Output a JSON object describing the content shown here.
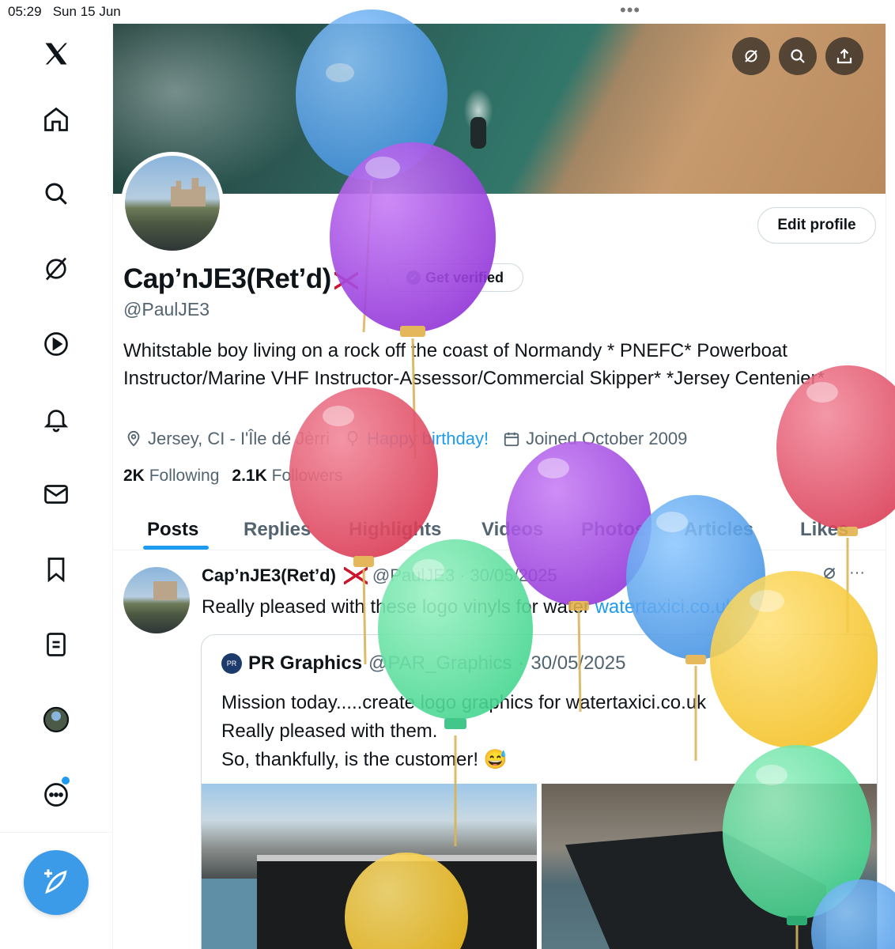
{
  "status": {
    "time": "05:29",
    "date": "Sun 15 Jun"
  },
  "banner": {
    "icons": [
      "grok-icon",
      "search-icon",
      "share-icon"
    ]
  },
  "profile": {
    "name": "Cap’nJE3(Ret’d)",
    "get_verified": "Get verified",
    "handle": "@PaulJE3",
    "bio": "Whitstable boy living on a rock off the coast of Normandy * PNEFC* Powerboat Instructor/Marine VHF Instructor-Assessor/Commercial Skipper* *Jersey Centenier*",
    "location": "Jersey, CI - I'Île dé Jèrri",
    "birthday": "Happy birthday!",
    "joined": "Joined October 2009",
    "following_count": "2K",
    "following_label": "Following",
    "followers_count": "2.1K",
    "followers_label": "Followers",
    "edit_button": "Edit profile"
  },
  "tabs": [
    "Posts",
    "Replies",
    "Highlights",
    "Videos",
    "Photos",
    "Articles",
    "Likes"
  ],
  "post": {
    "author": "Cap’nJE3(Ret’d)",
    "handle": "@PaulJE3",
    "date": "30/05/2025",
    "text": "Really pleased with these logo vinyls for water ",
    "link": "watertaxici.co.uk",
    "quote": {
      "author": "PR Graphics",
      "handle": "@PAR_Graphics",
      "date": "30/05/2025",
      "line1": "Mission today.....create logo graphics for watertaxici.co.uk",
      "line2": "Really pleased with them.",
      "line3": "So, thankfully, is the customer! 😅"
    }
  },
  "colors": {
    "accent": "#1d9bf0",
    "compose": "#3b9be9"
  }
}
